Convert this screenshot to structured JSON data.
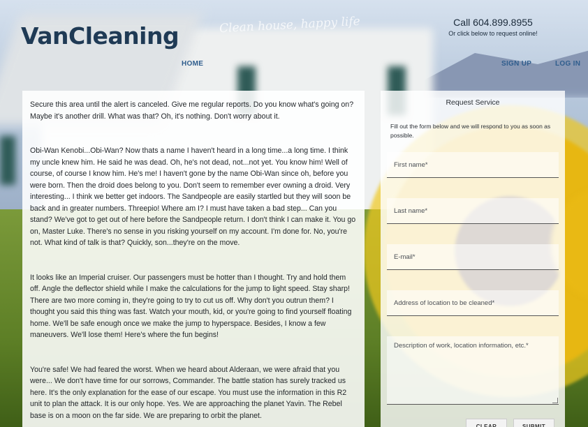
{
  "site": {
    "logo": "VanCleaning",
    "tagline": "Clean house, happy life",
    "phone": "Call 604.899.8955",
    "phone_note": "Or click below to request online!"
  },
  "nav": {
    "home": "HOME",
    "signup": "SIGN UP",
    "login": "LOG IN"
  },
  "content": {
    "paragraphs": [
      "Secure this area until the alert is canceled. Give me regular reports. Do you know what's going on? Maybe it's another drill. What was that? Oh, it's nothing. Don't worry about it.",
      "Obi-Wan Kenobi...Obi-Wan? Now thats a name I haven't heard in a long time...a long time. I think my uncle knew him. He said he was dead. Oh, he's not dead, not...not yet. You know him! Well of course, of course I know him. He's me! I haven't gone by the name Obi-Wan since oh, before you were born. Then the droid does belong to you. Don't seem to remember ever owning a droid. Very interesting... I think we better get indoors. The Sandpeople are easily startled but they will soon be back and in greater numbers. Threepio! Where am I? I must have taken a bad step... Can you stand? We've got to get out of here before the Sandpeople return. I don't think I can make it. You go on, Master Luke. There's no sense in you risking yourself on my account. I'm done for. No, you're not. What kind of talk is that? Quickly, son...they're on the move.",
      "It looks like an Imperial cruiser. Our passengers must be hotter than I thought. Try and hold them off. Angle the deflector shield while I make the calculations for the jump to light speed. Stay sharp! There are two more coming in, they're going to try to cut us off. Why don't you outrun them? I thought you said this thing was fast. Watch your mouth, kid, or you're going to find yourself floating home. We'll be safe enough once we make the jump to hyperspace. Besides, I know a few maneuvers. We'll lose them! Here's where the fun begins!",
      "You're safe! We had feared the worst. When we heard about Alderaan, we were afraid that you were... We don't have time for our sorrows, Commander. The battle station has surely tracked us here. It's the only explanation for the ease of our escape. You must use the information in this R2 unit to plan the attack. It is our only hope. Yes. We are approaching the planet Yavin. The Rebel base is on a moon on the far side. We are preparing to orbit the planet."
    ]
  },
  "form": {
    "title": "Request Service",
    "description": "Fill out the form below and we will respond to you as soon as possible.",
    "first_name_placeholder": "First name*",
    "last_name_placeholder": "Last name*",
    "email_placeholder": "E-mail*",
    "address_placeholder": "Address of location to be cleaned*",
    "description_placeholder": "Description of work, location information, etc.*",
    "clear_label": "CLEAR",
    "submit_label": "SUBMIT"
  }
}
